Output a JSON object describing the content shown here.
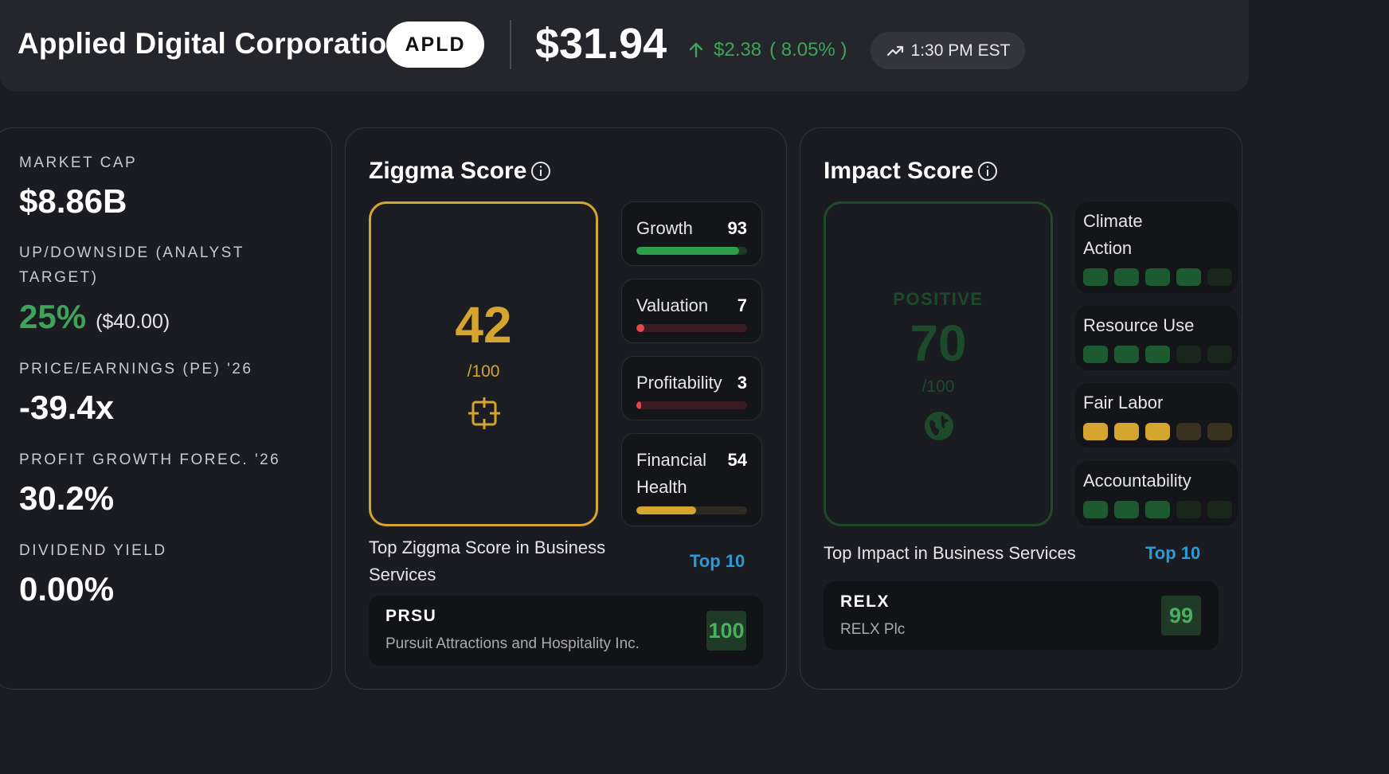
{
  "header": {
    "company": "Applied Digital Corporation",
    "ticker": "APLD",
    "price": "$31.94",
    "change_amount": "$2.38",
    "change_percent": "( 8.05% )",
    "time": "1:30 PM EST"
  },
  "market": {
    "market_cap_label": "MARKET CAP",
    "market_cap_value": "$8.86B",
    "updown_label_line1": "UP/DOWNSIDE (ANALYST",
    "updown_label_line2": "TARGET)",
    "updown_percent": "25%",
    "updown_target": "($40.00)",
    "pe_label": "PRICE/EARNINGS (PE) '26",
    "pe_value": "-39.4x",
    "profit_growth_label": "PROFIT GROWTH FOREC. '26",
    "profit_growth_value": "30.2%",
    "dividend_label": "DIVIDEND YIELD",
    "dividend_value": "0.00%"
  },
  "ziggma": {
    "title": "Ziggma Score",
    "score": "42",
    "out_of": "/100",
    "metrics": [
      {
        "name": "Growth",
        "value": "93",
        "fill": 0.93,
        "color": "#2f9e4a",
        "track": "#1a3a24"
      },
      {
        "name": "Valuation",
        "value": "7",
        "fill": 0.07,
        "color": "#e0484c",
        "track": "#3a1c22"
      },
      {
        "name": "Profitability",
        "value": "3",
        "fill": 0.03,
        "color": "#e0484c",
        "track": "#3a1c22"
      },
      {
        "name_line1": "Financial",
        "name_line2": "Health",
        "value": "54",
        "fill": 0.54,
        "color": "#d6a52f",
        "track": "#2e2a22"
      }
    ],
    "top_caption_line1": "Top Ziggma Score in Business",
    "top_caption_line2": "Services",
    "top_link": "Top 10",
    "top_item": {
      "symbol": "PRSU",
      "name": "Pursuit Attractions and Hospitality Inc.",
      "score": "100"
    }
  },
  "impact": {
    "title": "Impact Score",
    "label": "POSITIVE",
    "score": "70",
    "out_of": "/100",
    "factors": [
      {
        "name_line1": "Climate",
        "name_line2": "Action",
        "filled": 4,
        "total": 5,
        "color": "green"
      },
      {
        "name": "Resource Use",
        "filled": 3,
        "total": 5,
        "color": "green"
      },
      {
        "name": "Fair Labor",
        "filled": 3,
        "total": 5,
        "color": "yellow"
      },
      {
        "name": "Accountability",
        "filled": 3,
        "total": 5,
        "color": "green"
      }
    ],
    "top_caption": "Top Impact in Business Services",
    "top_link": "Top 10",
    "top_item": {
      "symbol": "RELX",
      "name": "RELX Plc",
      "score": "99"
    }
  },
  "icons": {
    "change_arrow": "arrow-up-icon",
    "time": "trending-up-icon",
    "info": "info-icon",
    "ziggma": "crosshair-icon",
    "impact": "globe-icon"
  }
}
